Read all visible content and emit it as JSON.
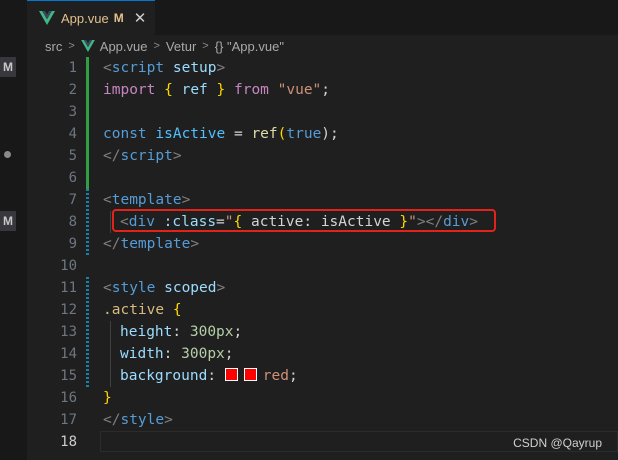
{
  "tab": {
    "filename": "App.vue",
    "status": "M",
    "close_glyph": "✕"
  },
  "left_strip": {
    "badges": [
      "M",
      "M"
    ]
  },
  "breadcrumb": {
    "items": [
      "src",
      "App.vue",
      "Vetur",
      "{} \"App.vue\""
    ],
    "separator": ">"
  },
  "line_numbers": [
    "1",
    "2",
    "3",
    "4",
    "5",
    "6",
    "7",
    "8",
    "9",
    "10",
    "11",
    "12",
    "13",
    "14",
    "15",
    "16",
    "17",
    "18"
  ],
  "code": {
    "l1": [
      "<",
      "script",
      " setup",
      ">"
    ],
    "l2": [
      "import",
      " ",
      "{",
      " ref ",
      "}",
      " from ",
      "\"vue\"",
      ";"
    ],
    "l4": [
      "const",
      " ",
      "isActive",
      " = ",
      "ref",
      "(",
      "true",
      ");"
    ],
    "l5": [
      "</",
      "script",
      ">"
    ],
    "l7": [
      "<",
      "template",
      ">"
    ],
    "l8": [
      "<",
      "div",
      " :class",
      "=",
      "\"",
      "{",
      " active: ",
      "isActive",
      " ",
      "}",
      "\"",
      "></",
      "div",
      ">"
    ],
    "l9": [
      "</",
      "template",
      ">"
    ],
    "l11": [
      "<",
      "style",
      " scoped",
      ">"
    ],
    "l12": [
      ".active",
      " ",
      "{"
    ],
    "l13": [
      "height",
      ": ",
      "300px",
      ";"
    ],
    "l14": [
      "width",
      ": ",
      "300px",
      ";"
    ],
    "l15": [
      "background",
      ": ",
      "red",
      ";"
    ],
    "l16": [
      "}"
    ],
    "l17": [
      "</",
      "style",
      ">"
    ]
  },
  "colors": {
    "accent": "#0078d4",
    "highlight": "#e2231a",
    "swatch": "#ff0000"
  },
  "watermark": "CSDN @Qayrup"
}
